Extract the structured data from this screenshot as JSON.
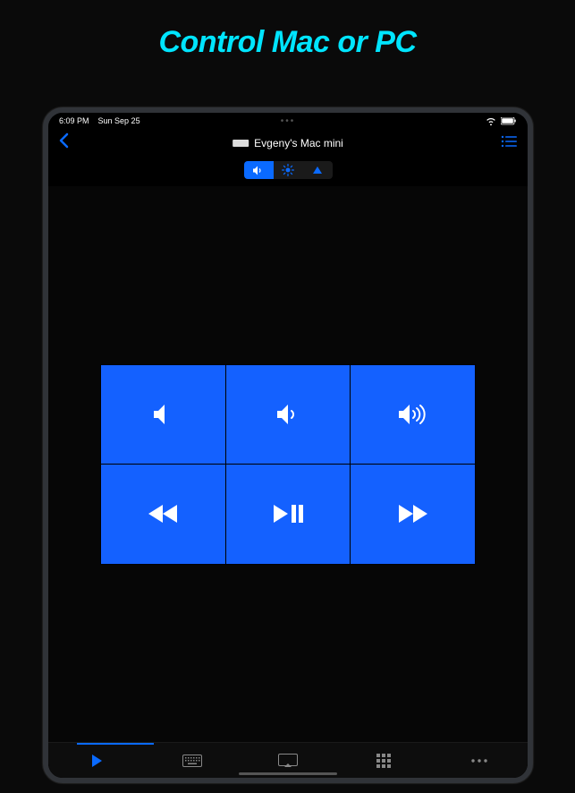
{
  "headline": "Control Mac or PC",
  "status": {
    "time": "6:09 PM",
    "date": "Sun Sep 25"
  },
  "device": {
    "name": "Evgeny's Mac mini"
  },
  "segments": {
    "volume": "volume",
    "brightness": "brightness",
    "media": "media"
  },
  "controls": {
    "mute": "mute",
    "volumeDown": "volume-down",
    "volumeUp": "volume-up",
    "rewind": "rewind",
    "playPause": "play-pause",
    "forward": "forward"
  },
  "tabs": {
    "remote": "remote",
    "keyboard": "keyboard",
    "screen": "screen",
    "apps": "apps",
    "more": "more"
  }
}
